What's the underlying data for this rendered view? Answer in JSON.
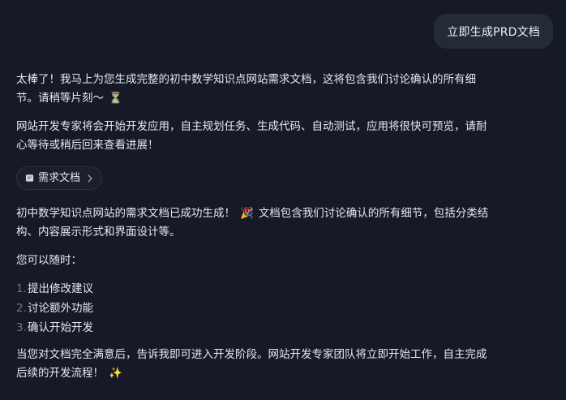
{
  "user_message": "立即生成PRD文档",
  "assistant": {
    "para1": "太棒了！我马上为您生成完整的初中数学知识点网站需求文档，这将包含我们讨论确认的所有细节。请稍等片刻～",
    "para1_emoji": "⏳",
    "para2": "网站开发专家将会开始开发应用，自主规划任务、生成代码、自动测试，应用将很快可预览，请耐心等待或稍后回来查看进展！",
    "doc_chip_label": "需求文档",
    "para3": "初中数学知识点网站的需求文档已成功生成！",
    "para3_emoji": "🎉",
    "para3_rest": "文档包含我们讨论确认的所有细节，包括分类结构、内容展示形式和界面设计等。",
    "para4": "您可以随时：",
    "steps": [
      {
        "num": "1.",
        "text": "提出修改建议"
      },
      {
        "num": "2.",
        "text": "讨论额外功能"
      },
      {
        "num": "3.",
        "text": "确认开始开发"
      }
    ],
    "para5": "当您对文档完全满意后，告诉我即可进入开发阶段。网站开发专家团队将立即开始工作，自主完成后续的开发流程！",
    "para5_emoji": "✨"
  }
}
